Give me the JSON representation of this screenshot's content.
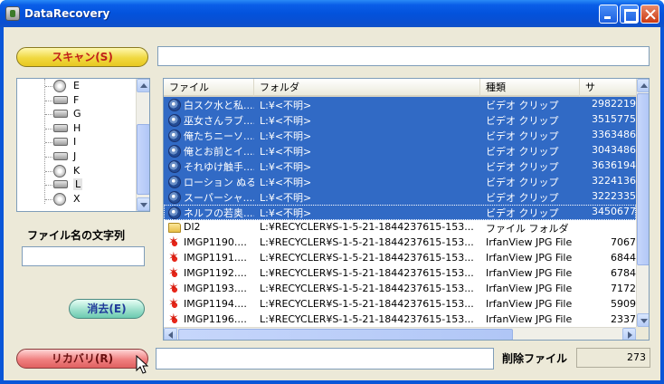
{
  "window": {
    "title": "DataRecovery"
  },
  "buttons": {
    "scan": "スキャン(S)",
    "clear": "消去(E)",
    "recover": "リカバリ(R)"
  },
  "path_input": {
    "value": ""
  },
  "filename_filter": {
    "label": "ファイル名の文字列",
    "value": ""
  },
  "drive_tree": {
    "items": [
      {
        "label": "E",
        "icon": "cd-drive-icon"
      },
      {
        "label": "F",
        "icon": "drive-icon"
      },
      {
        "label": "G",
        "icon": "drive-icon"
      },
      {
        "label": "H",
        "icon": "drive-icon"
      },
      {
        "label": "I",
        "icon": "drive-icon"
      },
      {
        "label": "J",
        "icon": "drive-icon"
      },
      {
        "label": "K",
        "icon": "cd-drive-icon"
      },
      {
        "label": "L",
        "icon": "drive-icon",
        "selected": true
      },
      {
        "label": "X",
        "icon": "cd-drive-icon"
      }
    ]
  },
  "file_list": {
    "columns": [
      "ファイル",
      "フォルダ",
      "種類",
      "サ"
    ],
    "rows": [
      {
        "name": "白スク水と私....",
        "folder": "L:¥<不明>",
        "type": "ビデオ クリップ",
        "size": "2982219",
        "icon": "video",
        "selected": true
      },
      {
        "name": "巫女さんラブ....",
        "folder": "L:¥<不明>",
        "type": "ビデオ クリップ",
        "size": "3515775",
        "icon": "video",
        "selected": true
      },
      {
        "name": "俺たちニーソ....",
        "folder": "L:¥<不明>",
        "type": "ビデオ クリップ",
        "size": "3363486",
        "icon": "video",
        "selected": true
      },
      {
        "name": "俺とお前とイ....",
        "folder": "L:¥<不明>",
        "type": "ビデオ クリップ",
        "size": "3043486",
        "icon": "video",
        "selected": true
      },
      {
        "name": "それゆけ触手....",
        "folder": "L:¥<不明>",
        "type": "ビデオ クリップ",
        "size": "3636194",
        "icon": "video",
        "selected": true
      },
      {
        "name": "ローション ぬる....",
        "folder": "L:¥<不明>",
        "type": "ビデオ クリップ",
        "size": "3224136",
        "icon": "video",
        "selected": true
      },
      {
        "name": "スーパーシャ....",
        "folder": "L:¥<不明>",
        "type": "ビデオ クリップ",
        "size": "3222335",
        "icon": "video",
        "selected": true
      },
      {
        "name": "ネルフの若奥....",
        "folder": "L:¥<不明>",
        "type": "ビデオ クリップ",
        "size": "3450677",
        "icon": "video",
        "selected": true
      },
      {
        "name": "Dl2",
        "folder": "L:¥RECYCLER¥S-1-5-21-1844237615-153...",
        "type": "ファイル フォルダ",
        "size": "",
        "icon": "folder",
        "selected": false
      },
      {
        "name": "IMGP1190....",
        "folder": "L:¥RECYCLER¥S-1-5-21-1844237615-153...",
        "type": "IrfanView JPG File",
        "size": "7067",
        "icon": "image",
        "selected": false
      },
      {
        "name": "IMGP1191....",
        "folder": "L:¥RECYCLER¥S-1-5-21-1844237615-153...",
        "type": "IrfanView JPG File",
        "size": "6844",
        "icon": "image",
        "selected": false
      },
      {
        "name": "IMGP1192....",
        "folder": "L:¥RECYCLER¥S-1-5-21-1844237615-153...",
        "type": "IrfanView JPG File",
        "size": "6784",
        "icon": "image",
        "selected": false
      },
      {
        "name": "IMGP1193....",
        "folder": "L:¥RECYCLER¥S-1-5-21-1844237615-153...",
        "type": "IrfanView JPG File",
        "size": "7172",
        "icon": "image",
        "selected": false
      },
      {
        "name": "IMGP1194....",
        "folder": "L:¥RECYCLER¥S-1-5-21-1844237615-153...",
        "type": "IrfanView JPG File",
        "size": "5909",
        "icon": "image",
        "selected": false
      },
      {
        "name": "IMGP1196....",
        "folder": "L:¥RECYCLER¥S-1-5-21-1844237615-153...",
        "type": "IrfanView JPG File",
        "size": "2337",
        "icon": "image",
        "selected": false
      }
    ]
  },
  "status": {
    "deleted_label": "削除ファイル",
    "deleted_count": "273"
  },
  "colors": {
    "title_bar": "#0a56d8",
    "selection": "#316ac5",
    "window_bg": "#ece9d8"
  }
}
